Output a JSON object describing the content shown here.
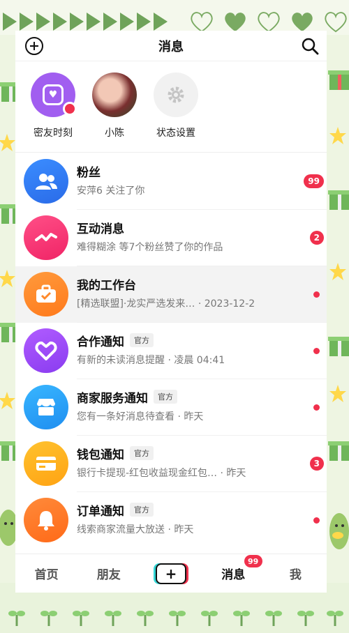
{
  "header": {
    "title": "消息",
    "add_icon": "plus-circle-icon",
    "search_icon": "search-icon"
  },
  "stories": [
    {
      "label": "密友时刻",
      "icon": "heart-frame-icon",
      "has_red_dot": true
    },
    {
      "label": "小陈",
      "icon": "user-avatar"
    },
    {
      "label": "状态设置",
      "icon": "gear-icon"
    }
  ],
  "messages": [
    {
      "name": "粉丝",
      "subtitle": "安萍6 关注了你",
      "icon": "users-icon",
      "badge": "99",
      "official": ""
    },
    {
      "name": "互动消息",
      "subtitle": "难得糊涂 等7个粉丝赞了你的作品",
      "icon": "zigzag-icon",
      "badge": "2",
      "official": ""
    },
    {
      "name": "我的工作台",
      "subtitle": "[精选联盟]·龙实严选发来… · 2023-12-2",
      "icon": "briefcase-icon",
      "dot": true,
      "official": ""
    },
    {
      "name": "合作通知",
      "subtitle": "有新的未读消息提醒 · 凌晨 04:41",
      "icon": "handshake-heart-icon",
      "dot": true,
      "official": "官方"
    },
    {
      "name": "商家服务通知",
      "subtitle": "您有一条好消息待查看 · 昨天",
      "icon": "store-icon",
      "dot": true,
      "official": "官方"
    },
    {
      "name": "钱包通知",
      "subtitle": "银行卡提现-红包收益现金红包… · 昨天",
      "icon": "card-icon",
      "badge": "3",
      "official": "官方"
    },
    {
      "name": "订单通知",
      "subtitle": "线索商家流量大放送 · 昨天",
      "icon": "bell-icon",
      "dot": true,
      "official": "官方"
    }
  ],
  "tabbar": {
    "home": "首页",
    "friends": "朋友",
    "plus": "+",
    "messages": "消息",
    "messages_badge": "99",
    "me": "我"
  },
  "colors": {
    "accent_red": "#f0304c",
    "frame_green": "#6fa35a"
  }
}
